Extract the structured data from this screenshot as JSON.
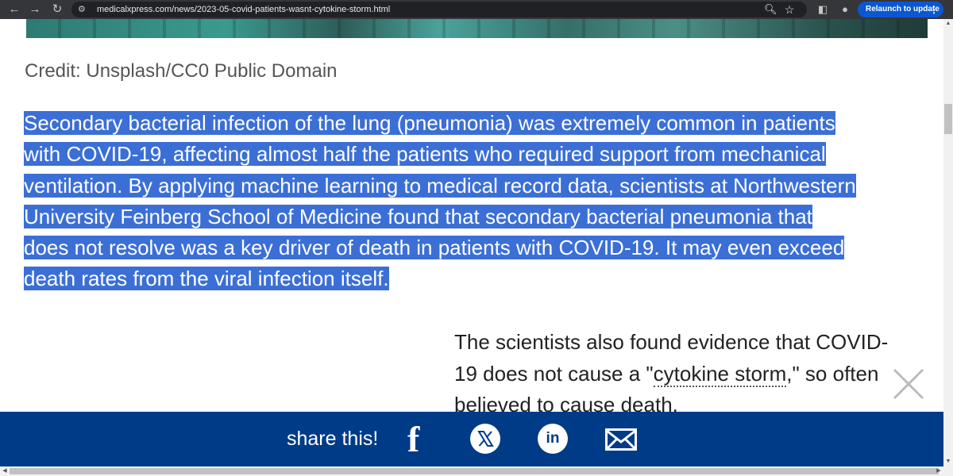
{
  "browser": {
    "url": "medicalxpress.com/news/2023-05-covid-patients-wasnt-cytokine-storm.html",
    "relaunch_label": "Relaunch to update",
    "menu_label": "⋮"
  },
  "article": {
    "credit": "Credit: Unsplash/CC0 Public Domain",
    "paragraph_lines": [
      "Secondary bacterial infection of the lung (pneumonia) was extremely common in patients",
      "with COVID-19, affecting almost half the patients who required support from mechanical",
      "ventilation. By applying machine learning to medical record data, scientists at Northwestern",
      "University Feinberg School of Medicine found that secondary bacterial pneumonia that",
      "does not resolve was a key driver of death in patients with COVID-19. It may even exceed",
      "death rates from the viral infection itself."
    ],
    "second_paragraph": {
      "line1": "The scientists also found evidence that COVID-",
      "line2_before": "19 does not cause a \"",
      "line2_link": "cytokine storm",
      "line2_after": ",\" so often",
      "line3": "believed to cause death."
    }
  },
  "share": {
    "label": "share this!",
    "facebook_glyph": "f",
    "linkedin_glyph": "in"
  },
  "icons": [
    "back-icon",
    "forward-icon",
    "reload-icon",
    "site-info-icon",
    "zoom-icon",
    "star-icon",
    "side-panel-icon",
    "profile-icon",
    "close-icon",
    "facebook-icon",
    "x-icon",
    "linkedin-icon",
    "mail-icon"
  ]
}
